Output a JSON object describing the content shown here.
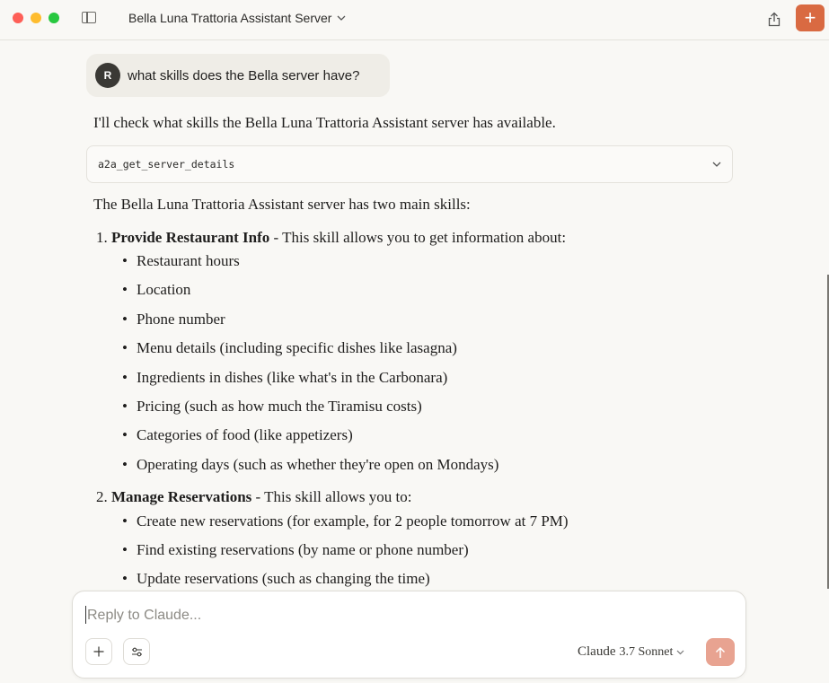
{
  "window": {
    "title": "Bella Luna Trattoria Assistant Server",
    "buttons": {
      "new_chat": "+"
    }
  },
  "user_message": {
    "avatar_initial": "R",
    "text": "what skills does the Bella server have?"
  },
  "assistant": {
    "intro": "I'll check what skills the Bella Luna Trattoria Assistant server has available.",
    "tool_call": "a2a_get_server_details",
    "summary": "The Bella Luna Trattoria Assistant server has two main skills:",
    "skills": [
      {
        "number": "1.",
        "name": "Provide Restaurant Info",
        "desc": " - This skill allows you to get information about:",
        "items": [
          "Restaurant hours",
          "Location",
          "Phone number",
          "Menu details (including specific dishes like lasagna)",
          "Ingredients in dishes (like what's in the Carbonara)",
          "Pricing (such as how much the Tiramisu costs)",
          "Categories of food (like appetizers)",
          "Operating days (such as whether they're open on Mondays)"
        ]
      },
      {
        "number": "2.",
        "name": "Manage Reservations",
        "desc": " - This skill allows you to:",
        "items": [
          "Create new reservations (for example, for 2 people tomorrow at 7 PM)",
          "Find existing reservations (by name or phone number)",
          "Update reservations (such as changing the time)"
        ]
      }
    ]
  },
  "composer": {
    "placeholder": "Reply to Claude...",
    "value": "",
    "model_name": "Claude",
    "model_version": "3.7 Sonnet"
  },
  "colors": {
    "accent": "#d96a42",
    "send_disabled": "#e8a391",
    "background": "#f9f8f5"
  }
}
